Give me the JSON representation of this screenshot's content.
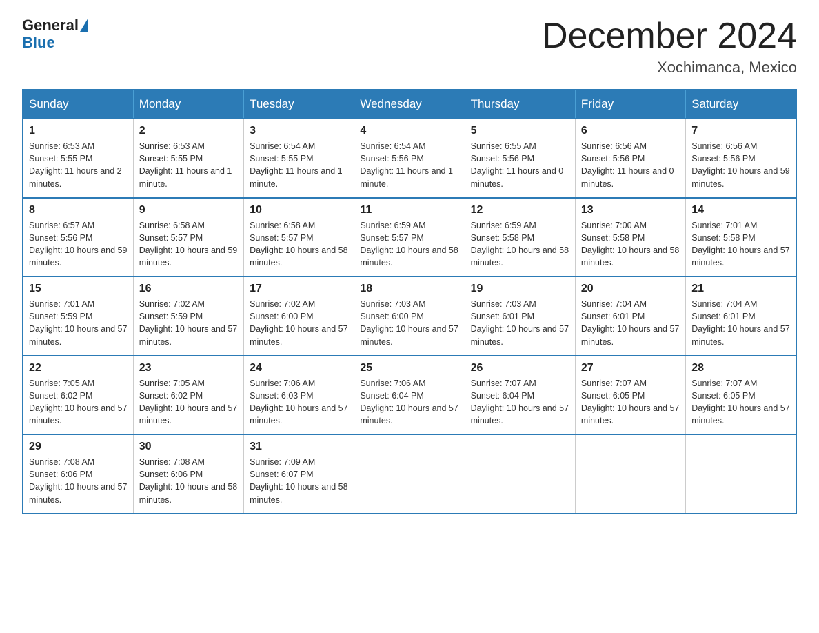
{
  "header": {
    "logo_general": "General",
    "logo_blue": "Blue",
    "title": "December 2024",
    "subtitle": "Xochimanca, Mexico"
  },
  "weekdays": [
    "Sunday",
    "Monday",
    "Tuesday",
    "Wednesday",
    "Thursday",
    "Friday",
    "Saturday"
  ],
  "weeks": [
    [
      {
        "day": "1",
        "sunrise": "6:53 AM",
        "sunset": "5:55 PM",
        "daylight": "11 hours and 2 minutes."
      },
      {
        "day": "2",
        "sunrise": "6:53 AM",
        "sunset": "5:55 PM",
        "daylight": "11 hours and 1 minute."
      },
      {
        "day": "3",
        "sunrise": "6:54 AM",
        "sunset": "5:55 PM",
        "daylight": "11 hours and 1 minute."
      },
      {
        "day": "4",
        "sunrise": "6:54 AM",
        "sunset": "5:56 PM",
        "daylight": "11 hours and 1 minute."
      },
      {
        "day": "5",
        "sunrise": "6:55 AM",
        "sunset": "5:56 PM",
        "daylight": "11 hours and 0 minutes."
      },
      {
        "day": "6",
        "sunrise": "6:56 AM",
        "sunset": "5:56 PM",
        "daylight": "11 hours and 0 minutes."
      },
      {
        "day": "7",
        "sunrise": "6:56 AM",
        "sunset": "5:56 PM",
        "daylight": "10 hours and 59 minutes."
      }
    ],
    [
      {
        "day": "8",
        "sunrise": "6:57 AM",
        "sunset": "5:56 PM",
        "daylight": "10 hours and 59 minutes."
      },
      {
        "day": "9",
        "sunrise": "6:58 AM",
        "sunset": "5:57 PM",
        "daylight": "10 hours and 59 minutes."
      },
      {
        "day": "10",
        "sunrise": "6:58 AM",
        "sunset": "5:57 PM",
        "daylight": "10 hours and 58 minutes."
      },
      {
        "day": "11",
        "sunrise": "6:59 AM",
        "sunset": "5:57 PM",
        "daylight": "10 hours and 58 minutes."
      },
      {
        "day": "12",
        "sunrise": "6:59 AM",
        "sunset": "5:58 PM",
        "daylight": "10 hours and 58 minutes."
      },
      {
        "day": "13",
        "sunrise": "7:00 AM",
        "sunset": "5:58 PM",
        "daylight": "10 hours and 58 minutes."
      },
      {
        "day": "14",
        "sunrise": "7:01 AM",
        "sunset": "5:58 PM",
        "daylight": "10 hours and 57 minutes."
      }
    ],
    [
      {
        "day": "15",
        "sunrise": "7:01 AM",
        "sunset": "5:59 PM",
        "daylight": "10 hours and 57 minutes."
      },
      {
        "day": "16",
        "sunrise": "7:02 AM",
        "sunset": "5:59 PM",
        "daylight": "10 hours and 57 minutes."
      },
      {
        "day": "17",
        "sunrise": "7:02 AM",
        "sunset": "6:00 PM",
        "daylight": "10 hours and 57 minutes."
      },
      {
        "day": "18",
        "sunrise": "7:03 AM",
        "sunset": "6:00 PM",
        "daylight": "10 hours and 57 minutes."
      },
      {
        "day": "19",
        "sunrise": "7:03 AM",
        "sunset": "6:01 PM",
        "daylight": "10 hours and 57 minutes."
      },
      {
        "day": "20",
        "sunrise": "7:04 AM",
        "sunset": "6:01 PM",
        "daylight": "10 hours and 57 minutes."
      },
      {
        "day": "21",
        "sunrise": "7:04 AM",
        "sunset": "6:01 PM",
        "daylight": "10 hours and 57 minutes."
      }
    ],
    [
      {
        "day": "22",
        "sunrise": "7:05 AM",
        "sunset": "6:02 PM",
        "daylight": "10 hours and 57 minutes."
      },
      {
        "day": "23",
        "sunrise": "7:05 AM",
        "sunset": "6:02 PM",
        "daylight": "10 hours and 57 minutes."
      },
      {
        "day": "24",
        "sunrise": "7:06 AM",
        "sunset": "6:03 PM",
        "daylight": "10 hours and 57 minutes."
      },
      {
        "day": "25",
        "sunrise": "7:06 AM",
        "sunset": "6:04 PM",
        "daylight": "10 hours and 57 minutes."
      },
      {
        "day": "26",
        "sunrise": "7:07 AM",
        "sunset": "6:04 PM",
        "daylight": "10 hours and 57 minutes."
      },
      {
        "day": "27",
        "sunrise": "7:07 AM",
        "sunset": "6:05 PM",
        "daylight": "10 hours and 57 minutes."
      },
      {
        "day": "28",
        "sunrise": "7:07 AM",
        "sunset": "6:05 PM",
        "daylight": "10 hours and 57 minutes."
      }
    ],
    [
      {
        "day": "29",
        "sunrise": "7:08 AM",
        "sunset": "6:06 PM",
        "daylight": "10 hours and 57 minutes."
      },
      {
        "day": "30",
        "sunrise": "7:08 AM",
        "sunset": "6:06 PM",
        "daylight": "10 hours and 58 minutes."
      },
      {
        "day": "31",
        "sunrise": "7:09 AM",
        "sunset": "6:07 PM",
        "daylight": "10 hours and 58 minutes."
      },
      null,
      null,
      null,
      null
    ]
  ]
}
